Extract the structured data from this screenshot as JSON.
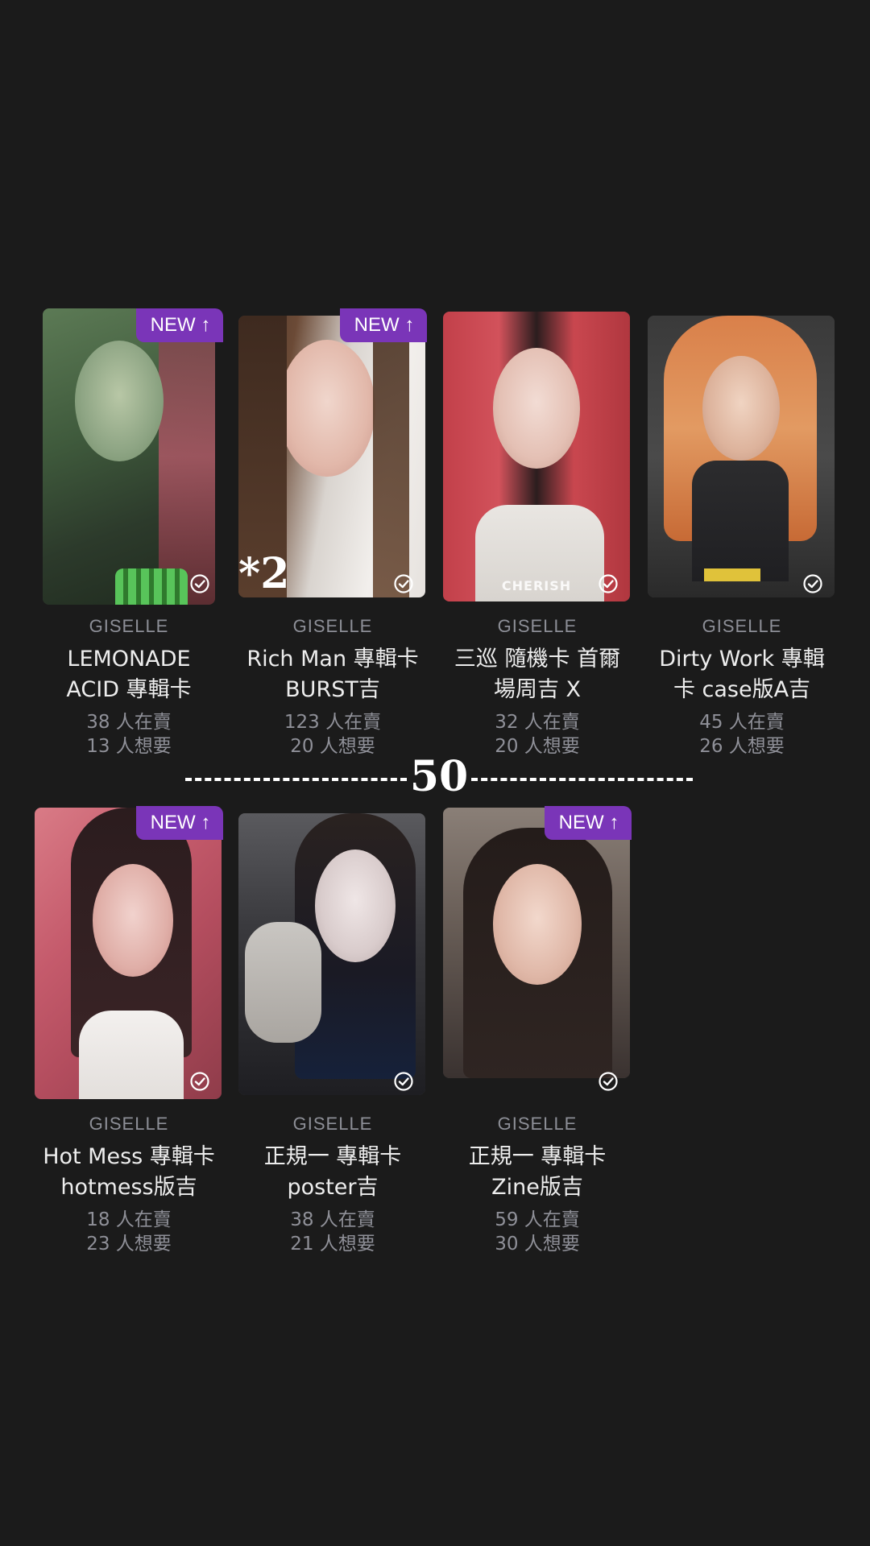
{
  "badges": {
    "new_label": "NEW ↑"
  },
  "annotations": {
    "multiplier": "*2",
    "divider_number": "50"
  },
  "colors": {
    "background": "#1b1b1b",
    "badge": "#7a35b8",
    "artist_text": "#8d8f97",
    "name_text": "#ededed",
    "stats_text": "#8f9098"
  },
  "cards": [
    {
      "artist": "GISELLE",
      "name_line1": "LEMONADE",
      "name_line2": "ACID 專輯卡",
      "selling": "38 人在賣",
      "wanting": "13 人想要",
      "is_new": true,
      "icon": "check-circle-icon"
    },
    {
      "artist": "GISELLE",
      "name_line1": "Rich Man 專輯卡",
      "name_line2": "BURST吉",
      "selling": "123 人在賣",
      "wanting": "20 人想要",
      "is_new": true,
      "icon": "check-circle-icon"
    },
    {
      "artist": "GISELLE",
      "name_line1": "三巡 隨機卡 首爾",
      "name_line2": "場周吉 X",
      "selling": "32 人在賣",
      "wanting": "20 人想要",
      "is_new": false,
      "photo_caption": "CHERISH",
      "icon": "check-circle-icon"
    },
    {
      "artist": "GISELLE",
      "name_line1": "Dirty Work 專輯",
      "name_line2": "卡 case版A吉",
      "selling": "45 人在賣",
      "wanting": "26 人想要",
      "is_new": false,
      "icon": "check-circle-icon"
    },
    {
      "artist": "GISELLE",
      "name_line1": "Hot Mess 專輯卡",
      "name_line2": "hotmess版吉",
      "selling": "18 人在賣",
      "wanting": "23 人想要",
      "is_new": true,
      "icon": "check-circle-icon"
    },
    {
      "artist": "GISELLE",
      "name_line1": "正規一 專輯卡",
      "name_line2": "poster吉",
      "selling": "38 人在賣",
      "wanting": "21 人想要",
      "is_new": false,
      "icon": "check-circle-icon"
    },
    {
      "artist": "GISELLE",
      "name_line1": "正規一 專輯卡",
      "name_line2": "Zine版吉",
      "selling": "59 人在賣",
      "wanting": "30 人想要",
      "is_new": true,
      "icon": "check-circle-icon"
    }
  ]
}
